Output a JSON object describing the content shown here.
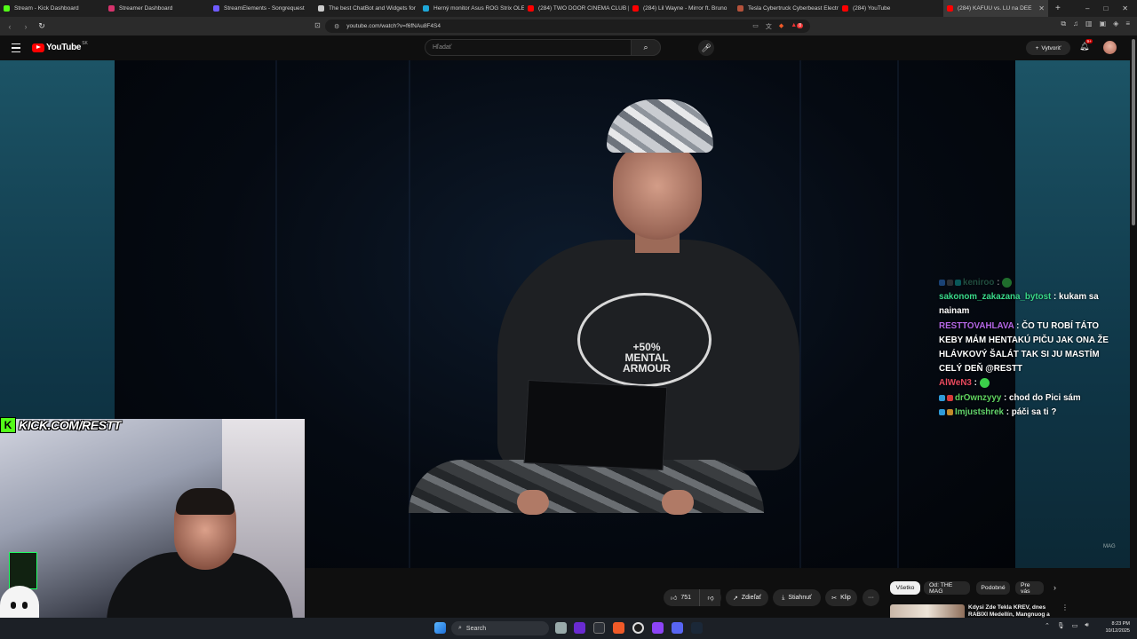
{
  "browser": {
    "tabs": [
      {
        "title": "Stream - Kick Dashboard",
        "color": "#53fc18"
      },
      {
        "title": "Streamer Dashboard",
        "color": "#d6336c"
      },
      {
        "title": "StreamElements - Songrequest",
        "color": "#6f5bff"
      },
      {
        "title": "The best ChatBot and Widgets for",
        "color": "#cccccc"
      },
      {
        "title": "Herný monitor Asus ROG Strix OLE",
        "color": "#1ea7d8"
      },
      {
        "title": "(284) TWO DOOR CINEMA CLUB |",
        "color": "#ff0000"
      },
      {
        "title": "(284) Lil Wayne - Mirror ft. Bruno",
        "color": "#ff0000"
      },
      {
        "title": "Tesla Cybertruck Cyberbeast Electr",
        "color": "#b5523b"
      },
      {
        "title": "(284) YouTube",
        "color": "#ff0000"
      },
      {
        "title": "(284) KAFUU vs. LU na DEE",
        "color": "#ff0000",
        "active": true
      }
    ],
    "new_tab": "+",
    "window_controls": [
      "–",
      "□",
      "✕"
    ],
    "url": "youtube.com/watch?v=f6fNAu8F4S4",
    "ext_badge": "8"
  },
  "youtube": {
    "logo_text": "YouTube",
    "country": "SK",
    "search_placeholder": "Hľadať",
    "create_label": "Vytvoriť",
    "notifications_badge": "9+"
  },
  "chat": [
    {
      "user": "keniroo",
      "user_color": "#3c8f6e",
      "message": "",
      "badges": [
        "#2f7bd8",
        "#555555",
        "#0ea5a0"
      ],
      "emote": true,
      "faded": true
    },
    {
      "user": "sakonom_zakazana_bytost",
      "user_color": "#39d98a",
      "message": "kukam sa nainam",
      "badges": [],
      "emote": false
    },
    {
      "user": "RESTTOVAHLAVA",
      "user_color": "#b567e6",
      "message": "ČO TU ROBÍ TÁTO KEBY MÁM HENTAKÚ PIČU JAK ONA ŽE HLÁVKOVÝ ŠALÁT TAK SI JU MASTÍM CELÝ DEŇ @RESTT",
      "badges": [],
      "emote": false
    },
    {
      "user": "AlWeN3",
      "user_color": "#e84a5f",
      "message": "",
      "badges": [],
      "emote": true
    },
    {
      "user": "drOwnzyyy",
      "user_color": "#5fd35f",
      "message": "chod do Pici sám",
      "badges": [
        "#2f9bd8",
        "#d83a3a"
      ],
      "emote": false
    },
    {
      "user": "Imjustshrek",
      "user_color": "#62d36b",
      "message": "páči sa ti ?",
      "badges": [
        "#2f9bd8",
        "#c28a2a"
      ],
      "emote": false
    }
  ],
  "overlay": {
    "kick_logo": "K",
    "kick_text": "KICK.COM/RESTT",
    "video_watermark": "MAG",
    "shirt_print": "+50%\nMENTAL\nARMOUR"
  },
  "actions": {
    "like_count": "751",
    "share_label": "Zdieľať",
    "download_label": "Stiahnuť",
    "clip_label": "Klip",
    "more_label": "···"
  },
  "filter_chips": [
    {
      "label": "Všetko",
      "selected": true
    },
    {
      "label": "Od: THE MAG",
      "selected": false
    },
    {
      "label": "Podobné",
      "selected": false
    },
    {
      "label": "Pre vás",
      "selected": false
    }
  ],
  "recommendation": {
    "title": "Kdysi Zde Tekla KREV, dnes RABIXI Medellín, Mangnuog a"
  },
  "taskbar": {
    "search_label": "Search",
    "time": "8:23 PM",
    "date": "10/12/2025"
  }
}
